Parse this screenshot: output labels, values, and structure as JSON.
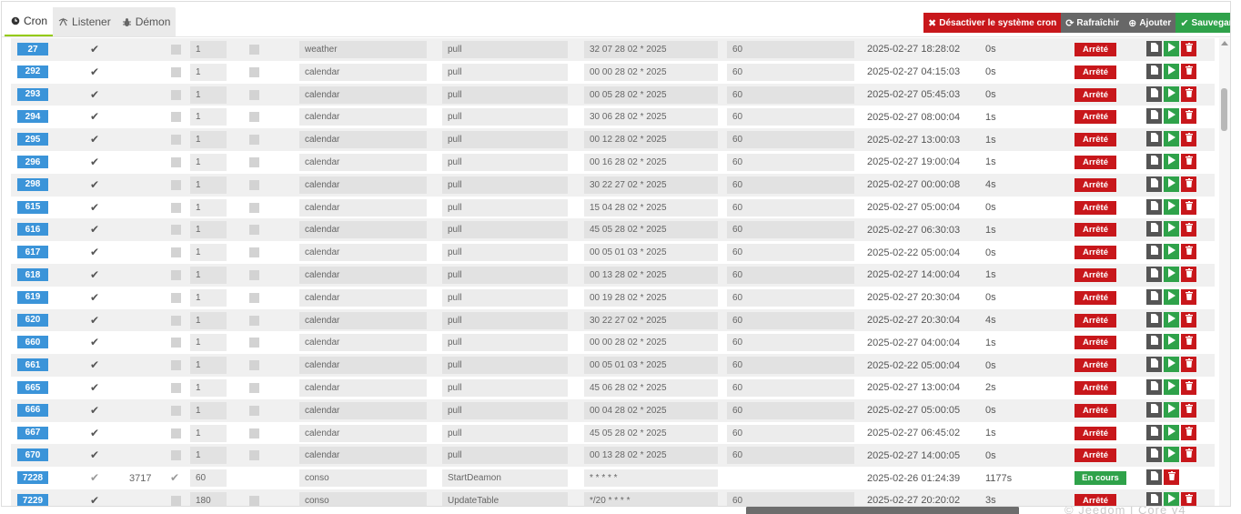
{
  "tabs": [
    {
      "label": "Cron",
      "icon": "clock-icon",
      "active": true
    },
    {
      "label": "Listener",
      "icon": "antenna-icon",
      "active": false
    },
    {
      "label": "Démon",
      "icon": "bug-icon",
      "active": false
    }
  ],
  "toolbar": {
    "disable_label": "Désactiver le système cron",
    "refresh_label": "Rafraîchir",
    "add_label": "Ajouter",
    "save_label": "Sauvegarder"
  },
  "colors": {
    "accent_red": "#c8171b",
    "accent_green": "#2fa24a",
    "accent_blue": "#3b94d9",
    "toolbar_gray": "#676767"
  },
  "footer": {
    "watermark": "© Jeedom | Core v4"
  },
  "rows": [
    {
      "id": "27",
      "enabled": true,
      "pid": "",
      "deamon_sleep": "1",
      "class": "weather",
      "function": "pull",
      "schedule": "32 07 28 02 * 2025",
      "timeout": "60",
      "last_run": "2025-02-27 18:28:02",
      "duration": "0s",
      "state": "Arrêté"
    },
    {
      "id": "292",
      "enabled": true,
      "pid": "",
      "deamon_sleep": "1",
      "class": "calendar",
      "function": "pull",
      "schedule": "00 00 28 02 * 2025",
      "timeout": "60",
      "last_run": "2025-02-27 04:15:03",
      "duration": "0s",
      "state": "Arrêté"
    },
    {
      "id": "293",
      "enabled": true,
      "pid": "",
      "deamon_sleep": "1",
      "class": "calendar",
      "function": "pull",
      "schedule": "00 05 28 02 * 2025",
      "timeout": "60",
      "last_run": "2025-02-27 05:45:03",
      "duration": "0s",
      "state": "Arrêté"
    },
    {
      "id": "294",
      "enabled": true,
      "pid": "",
      "deamon_sleep": "1",
      "class": "calendar",
      "function": "pull",
      "schedule": "30 06 28 02 * 2025",
      "timeout": "60",
      "last_run": "2025-02-27 08:00:04",
      "duration": "1s",
      "state": "Arrêté"
    },
    {
      "id": "295",
      "enabled": true,
      "pid": "",
      "deamon_sleep": "1",
      "class": "calendar",
      "function": "pull",
      "schedule": "00 12 28 02 * 2025",
      "timeout": "60",
      "last_run": "2025-02-27 13:00:03",
      "duration": "1s",
      "state": "Arrêté"
    },
    {
      "id": "296",
      "enabled": true,
      "pid": "",
      "deamon_sleep": "1",
      "class": "calendar",
      "function": "pull",
      "schedule": "00 16 28 02 * 2025",
      "timeout": "60",
      "last_run": "2025-02-27 19:00:04",
      "duration": "1s",
      "state": "Arrêté"
    },
    {
      "id": "298",
      "enabled": true,
      "pid": "",
      "deamon_sleep": "1",
      "class": "calendar",
      "function": "pull",
      "schedule": "30 22 27 02 * 2025",
      "timeout": "60",
      "last_run": "2025-02-27 00:00:08",
      "duration": "4s",
      "state": "Arrêté"
    },
    {
      "id": "615",
      "enabled": true,
      "pid": "",
      "deamon_sleep": "1",
      "class": "calendar",
      "function": "pull",
      "schedule": "15 04 28 02 * 2025",
      "timeout": "60",
      "last_run": "2025-02-27 05:00:04",
      "duration": "0s",
      "state": "Arrêté"
    },
    {
      "id": "616",
      "enabled": true,
      "pid": "",
      "deamon_sleep": "1",
      "class": "calendar",
      "function": "pull",
      "schedule": "45 05 28 02 * 2025",
      "timeout": "60",
      "last_run": "2025-02-27 06:30:03",
      "duration": "1s",
      "state": "Arrêté"
    },
    {
      "id": "617",
      "enabled": true,
      "pid": "",
      "deamon_sleep": "1",
      "class": "calendar",
      "function": "pull",
      "schedule": "00 05 01 03 * 2025",
      "timeout": "60",
      "last_run": "2025-02-22 05:00:04",
      "duration": "0s",
      "state": "Arrêté"
    },
    {
      "id": "618",
      "enabled": true,
      "pid": "",
      "deamon_sleep": "1",
      "class": "calendar",
      "function": "pull",
      "schedule": "00 13 28 02 * 2025",
      "timeout": "60",
      "last_run": "2025-02-27 14:00:04",
      "duration": "1s",
      "state": "Arrêté"
    },
    {
      "id": "619",
      "enabled": true,
      "pid": "",
      "deamon_sleep": "1",
      "class": "calendar",
      "function": "pull",
      "schedule": "00 19 28 02 * 2025",
      "timeout": "60",
      "last_run": "2025-02-27 20:30:04",
      "duration": "0s",
      "state": "Arrêté"
    },
    {
      "id": "620",
      "enabled": true,
      "pid": "",
      "deamon_sleep": "1",
      "class": "calendar",
      "function": "pull",
      "schedule": "30 22 27 02 * 2025",
      "timeout": "60",
      "last_run": "2025-02-27 20:30:04",
      "duration": "4s",
      "state": "Arrêté"
    },
    {
      "id": "660",
      "enabled": true,
      "pid": "",
      "deamon_sleep": "1",
      "class": "calendar",
      "function": "pull",
      "schedule": "00 00 28 02 * 2025",
      "timeout": "60",
      "last_run": "2025-02-27 04:00:04",
      "duration": "1s",
      "state": "Arrêté"
    },
    {
      "id": "661",
      "enabled": true,
      "pid": "",
      "deamon_sleep": "1",
      "class": "calendar",
      "function": "pull",
      "schedule": "00 05 01 03 * 2025",
      "timeout": "60",
      "last_run": "2025-02-22 05:00:04",
      "duration": "0s",
      "state": "Arrêté"
    },
    {
      "id": "665",
      "enabled": true,
      "pid": "",
      "deamon_sleep": "1",
      "class": "calendar",
      "function": "pull",
      "schedule": "45 06 28 02 * 2025",
      "timeout": "60",
      "last_run": "2025-02-27 13:00:04",
      "duration": "2s",
      "state": "Arrêté"
    },
    {
      "id": "666",
      "enabled": true,
      "pid": "",
      "deamon_sleep": "1",
      "class": "calendar",
      "function": "pull",
      "schedule": "00 04 28 02 * 2025",
      "timeout": "60",
      "last_run": "2025-02-27 05:00:05",
      "duration": "0s",
      "state": "Arrêté"
    },
    {
      "id": "667",
      "enabled": true,
      "pid": "",
      "deamon_sleep": "1",
      "class": "calendar",
      "function": "pull",
      "schedule": "45 05 28 02 * 2025",
      "timeout": "60",
      "last_run": "2025-02-27 06:45:02",
      "duration": "1s",
      "state": "Arrêté"
    },
    {
      "id": "670",
      "enabled": true,
      "pid": "",
      "deamon_sleep": "1",
      "class": "calendar",
      "function": "pull",
      "schedule": "00 13 28 02 * 2025",
      "timeout": "60",
      "last_run": "2025-02-27 14:00:05",
      "duration": "0s",
      "state": "Arrêté"
    },
    {
      "id": "7228",
      "enabled": true,
      "pid": "3717",
      "deamon": true,
      "deamon_sleep": "60",
      "class": "conso",
      "function": "StartDeamon",
      "schedule": "* * * * *",
      "timeout": "",
      "last_run": "2025-02-26 01:24:39",
      "duration": "1177s",
      "state": "En cours"
    },
    {
      "id": "7229",
      "enabled": true,
      "pid": "",
      "deamon_sleep": "180",
      "class": "conso",
      "function": "UpdateTable",
      "schedule": "*/20 * * * *",
      "timeout": "60",
      "last_run": "2025-02-27 20:20:02",
      "duration": "3s",
      "state": "Arrêté"
    }
  ]
}
